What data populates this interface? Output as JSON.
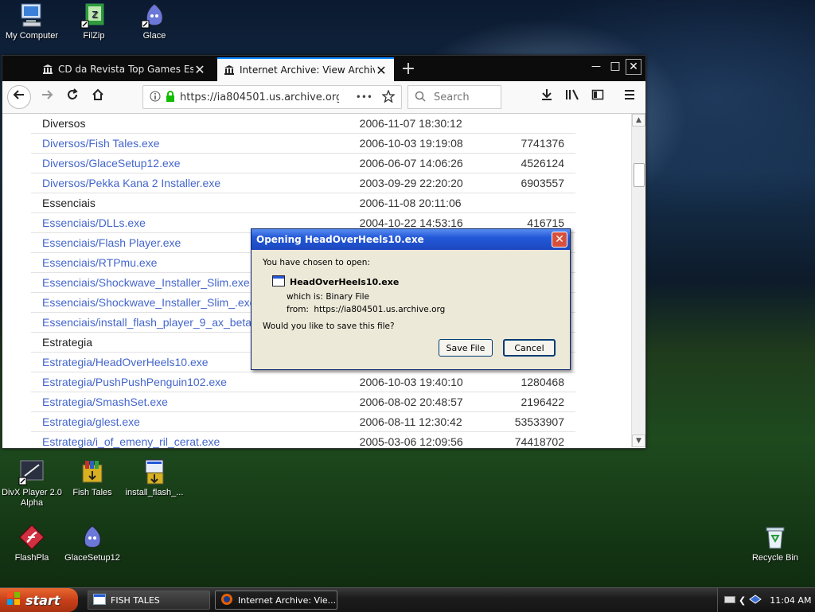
{
  "desktop": {
    "icons": [
      {
        "label": "My Computer"
      },
      {
        "label": "FilZip"
      },
      {
        "label": "Glace"
      },
      {
        "label": "DivX Player 2.0 Alpha"
      },
      {
        "label": "Fish Tales"
      },
      {
        "label": "install_flash_..."
      },
      {
        "label": "FlashPla"
      },
      {
        "label": "GlaceSetup12"
      },
      {
        "label": "Recycle Bin"
      }
    ]
  },
  "browser": {
    "tabs": [
      {
        "title": "CD da Revista Top Games Especial",
        "active": false
      },
      {
        "title": "Internet Archive: View Archive",
        "active": true
      }
    ],
    "window_controls": {
      "minimize": "—",
      "maximize": "□",
      "close": "✕"
    },
    "new_tab": "+",
    "url": "https://ia804501.us.archive.org",
    "url_more": "•••",
    "search_placeholder": "Search",
    "rows": [
      {
        "name": "Diversos",
        "date": "2006-11-07 18:30:12",
        "size": "",
        "link": false
      },
      {
        "name": "Diversos/Fish Tales.exe",
        "date": "2006-10-03 19:19:08",
        "size": "7741376",
        "link": true
      },
      {
        "name": "Diversos/GlaceSetup12.exe",
        "date": "2006-06-07 14:06:26",
        "size": "4526124",
        "link": true
      },
      {
        "name": "Diversos/Pekka Kana 2 Installer.exe",
        "date": "2003-09-29 22:20:20",
        "size": "6903557",
        "link": true
      },
      {
        "name": "Essenciais",
        "date": "2006-11-08 20:11:06",
        "size": "",
        "link": false
      },
      {
        "name": "Essenciais/DLLs.exe",
        "date": "2004-10-22 14:53:16",
        "size": "416715",
        "link": true
      },
      {
        "name": "Essenciais/Flash Player.exe",
        "date": "",
        "size": "",
        "link": true
      },
      {
        "name": "Essenciais/RTPmu.exe",
        "date": "",
        "size": "",
        "link": true
      },
      {
        "name": "Essenciais/Shockwave_Installer_Slim.exe",
        "date": "",
        "size": "",
        "link": true
      },
      {
        "name": "Essenciais/Shockwave_Installer_Slim_.exe",
        "date": "",
        "size": "",
        "link": true
      },
      {
        "name": "Essenciais/install_flash_player_9_ax_beta",
        "date": "",
        "size": "",
        "link": true
      },
      {
        "name": "Estrategia",
        "date": "",
        "size": "",
        "link": false
      },
      {
        "name": "Estrategia/HeadOverHeels10.exe",
        "date": "",
        "size": "",
        "link": true
      },
      {
        "name": "Estrategia/PushPushPenguin102.exe",
        "date": "2006-10-03 19:40:10",
        "size": "1280468",
        "link": true
      },
      {
        "name": "Estrategia/SmashSet.exe",
        "date": "2006-08-02 20:48:57",
        "size": "2196422",
        "link": true
      },
      {
        "name": "Estrategia/glest.exe",
        "date": "2006-08-11 12:30:42",
        "size": "53533907",
        "link": true
      },
      {
        "name": "Estrategia/i_of_emeny_ril_cerat.exe",
        "date": "2005-03-06 12:09:56",
        "size": "74418702",
        "link": true
      }
    ]
  },
  "dialog": {
    "title": "Opening HeadOverHeels10.exe",
    "intro": "You have chosen to open:",
    "filename": "HeadOverHeels10.exe",
    "which_is_label": "which is:",
    "which_is_value": "Binary File",
    "from_label": "from:",
    "from_value": "https://ia804501.us.archive.org",
    "question": "Would you like to save this file?",
    "save_label": "Save File",
    "cancel_label": "Cancel"
  },
  "taskbar": {
    "start_label": "start",
    "tasks": [
      {
        "label": "FISH TALES",
        "active": false
      },
      {
        "label": "Internet Archive: Vie...",
        "active": true
      }
    ],
    "clock": "11:04 AM"
  },
  "colors": {
    "link": "#4466cc",
    "firefox_accent": "#0a84ff",
    "xp_title": "#2358d8",
    "start_orange": "#c8401a"
  }
}
